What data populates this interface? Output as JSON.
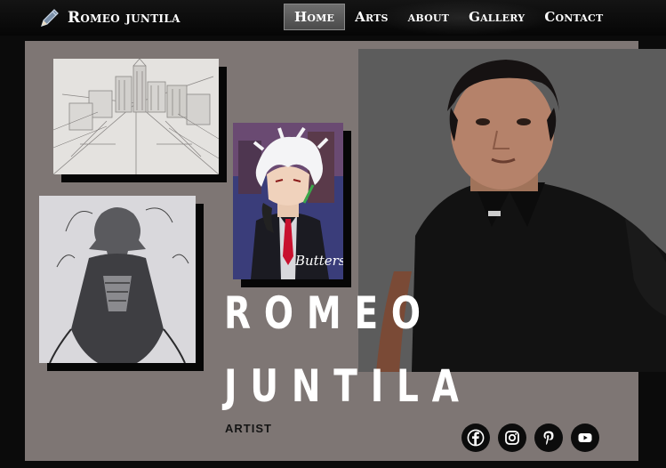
{
  "header": {
    "logo_text": "Romeo juntila",
    "logo_icon": "pencil-icon"
  },
  "nav": {
    "items": [
      {
        "label": "Home",
        "active": true
      },
      {
        "label": "Arts",
        "active": false
      },
      {
        "label": "about",
        "active": false
      },
      {
        "label": "Gallery",
        "active": false
      },
      {
        "label": "Contact",
        "active": false
      }
    ]
  },
  "hero": {
    "first_name": "ROMEO",
    "last_name": "JUNTILA",
    "subtitle": "ARTIST",
    "artwork_signature": "Butters"
  },
  "social": {
    "icons": [
      "facebook-icon",
      "instagram-icon",
      "pinterest-icon",
      "youtube-icon"
    ]
  },
  "colors": {
    "panel": "#7e7674",
    "photo_bg": "#5c5c5c",
    "accent_red": "#c8102e"
  }
}
